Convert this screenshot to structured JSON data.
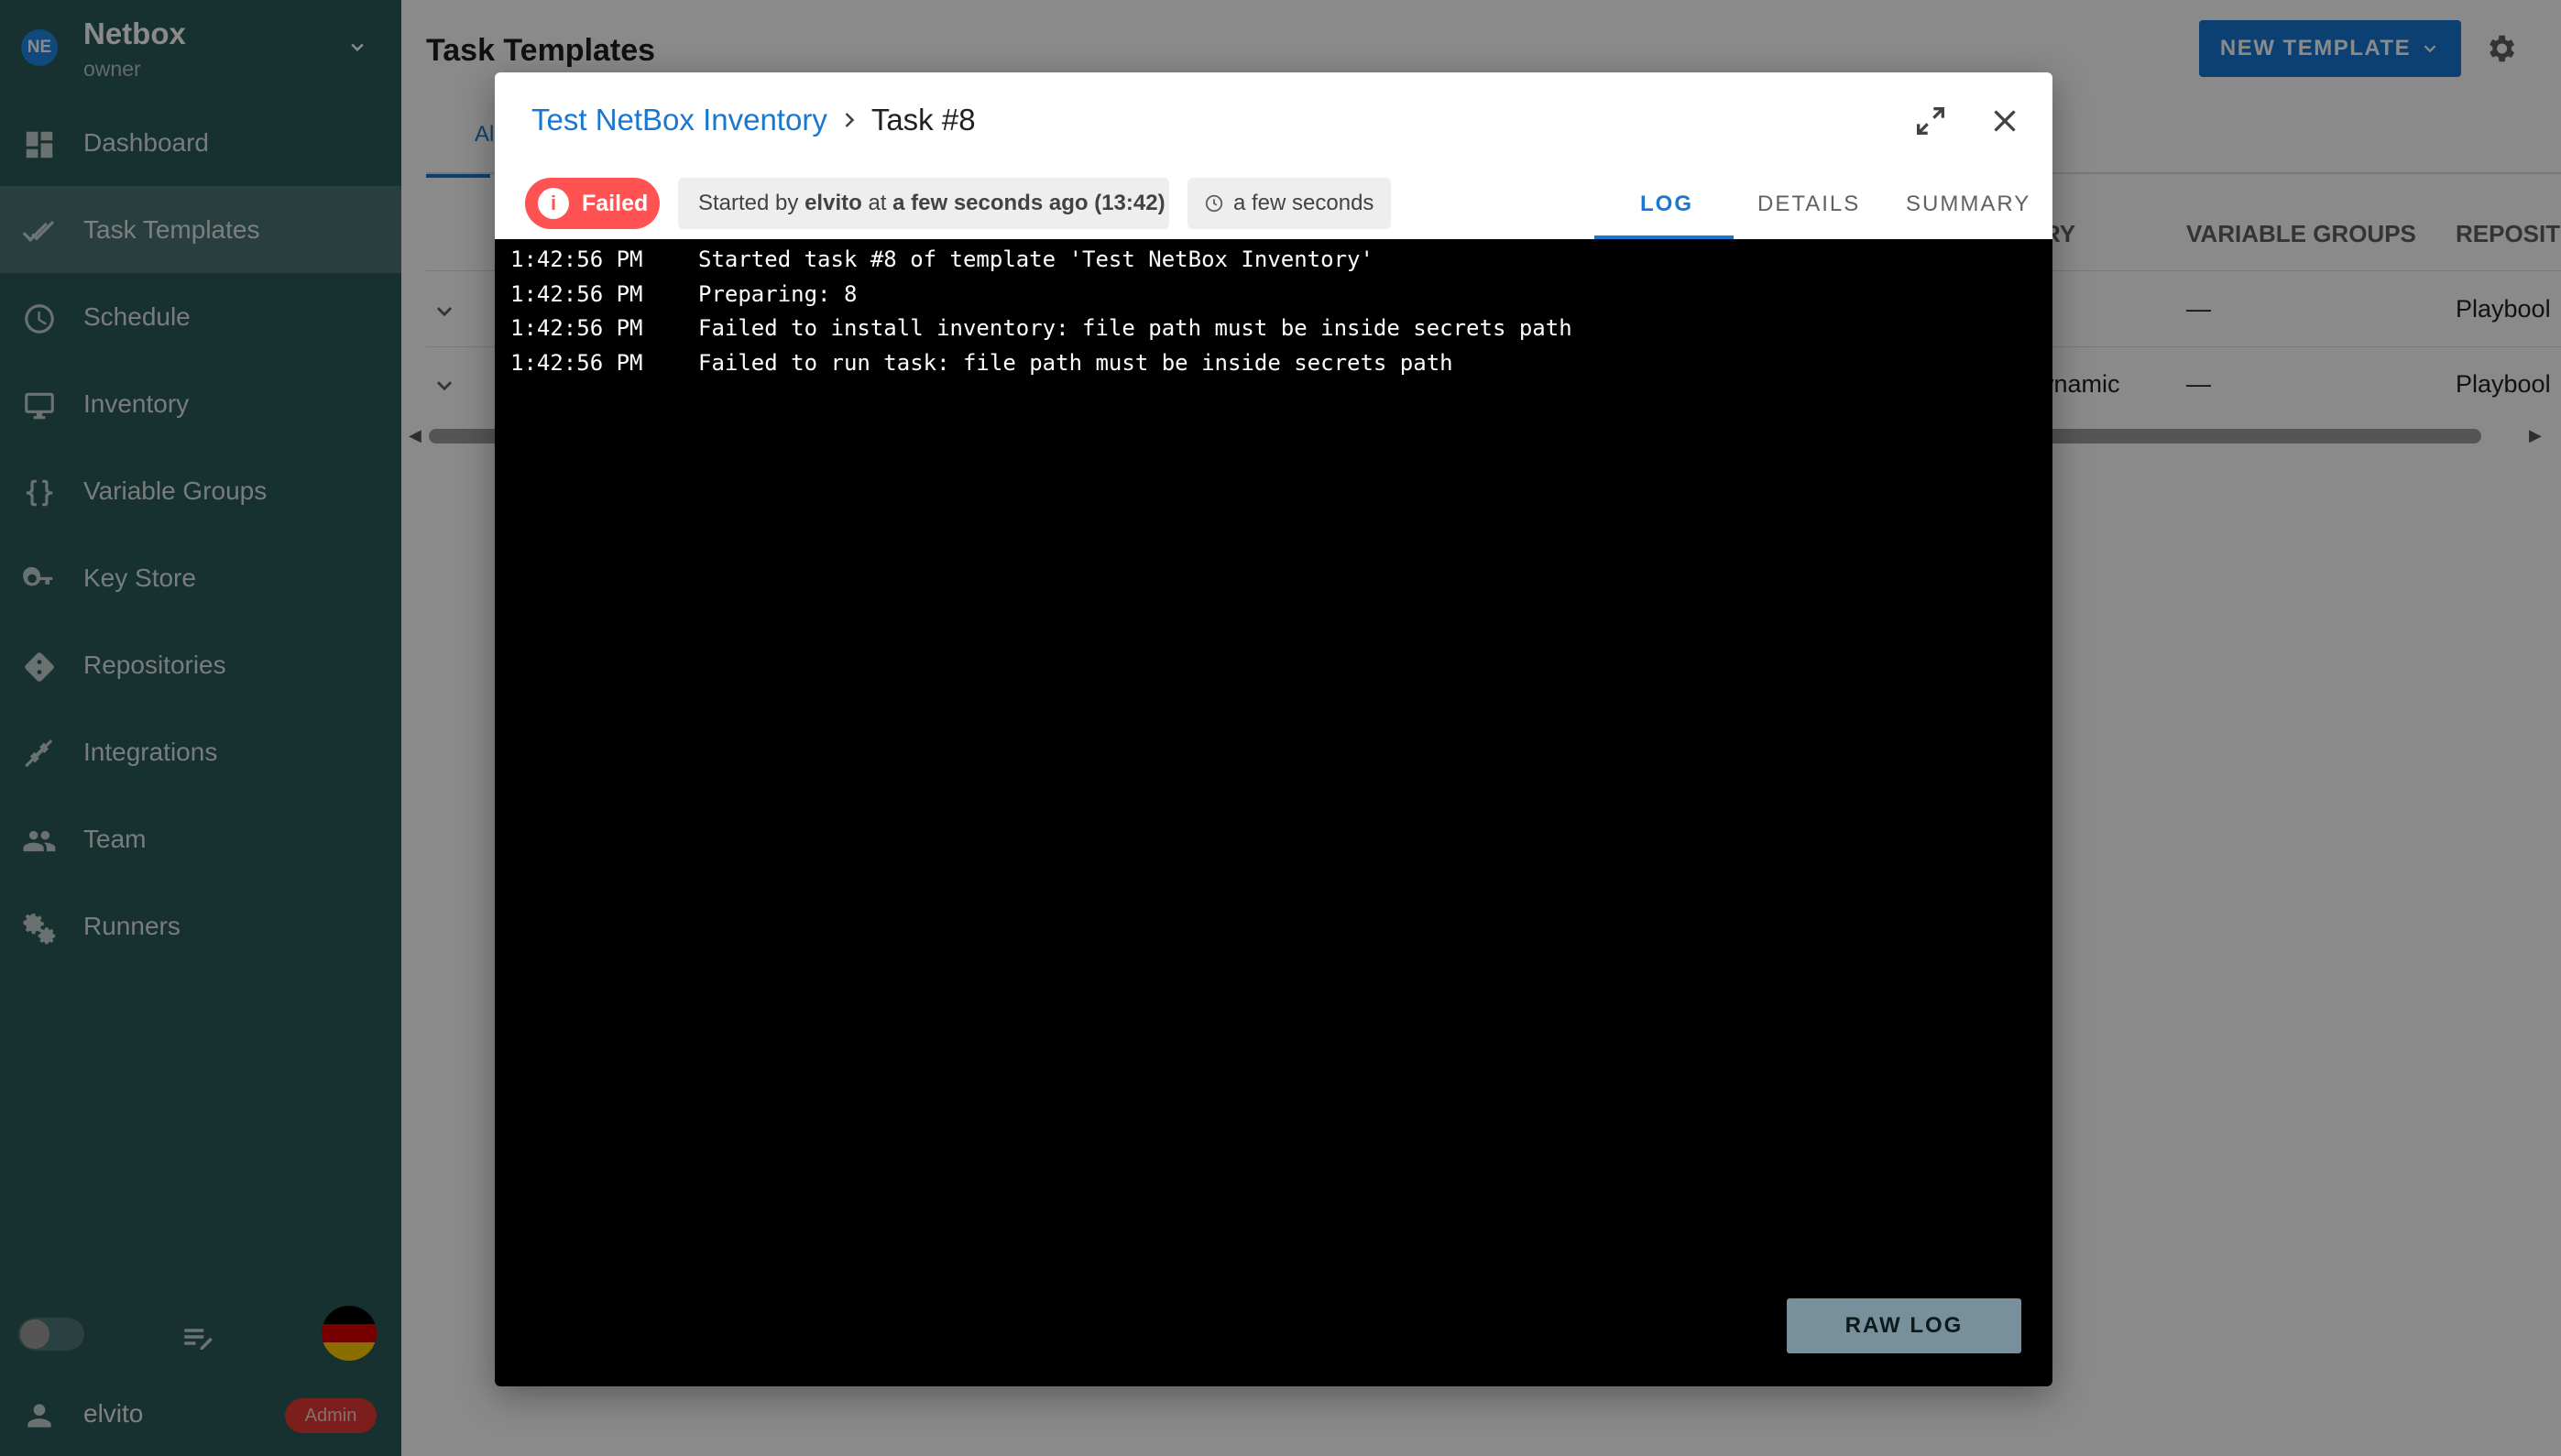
{
  "sidebar": {
    "project": {
      "initials": "NE",
      "name": "Netbox",
      "role": "owner"
    },
    "items": [
      {
        "label": "Dashboard",
        "icon": "dashboard-icon"
      },
      {
        "label": "Task Templates",
        "icon": "checks-icon",
        "active": true
      },
      {
        "label": "Schedule",
        "icon": "clock-icon"
      },
      {
        "label": "Inventory",
        "icon": "monitor-icon"
      },
      {
        "label": "Variable Groups",
        "icon": "braces-icon"
      },
      {
        "label": "Key Store",
        "icon": "key-icon"
      },
      {
        "label": "Repositories",
        "icon": "git-icon"
      },
      {
        "label": "Integrations",
        "icon": "plug-icon"
      },
      {
        "label": "Team",
        "icon": "team-icon"
      },
      {
        "label": "Runners",
        "icon": "cogs-icon"
      }
    ],
    "user": {
      "name": "elvito",
      "badge": "Admin"
    }
  },
  "page": {
    "title": "Task Templates",
    "new_button": "NEW TEMPLATE",
    "tab_partial": "Al",
    "table": {
      "headers": [
        "RY",
        "VARIABLE GROUPS",
        "REPOSIT"
      ],
      "rows": [
        {
          "inventory": "",
          "variable_groups": "—",
          "repository": "Playbool"
        },
        {
          "inventory": "ynamic",
          "variable_groups": "—",
          "repository": "Playbool"
        }
      ]
    }
  },
  "dialog": {
    "template_name": "Test NetBox Inventory",
    "task": "Task #8",
    "status": "Failed",
    "started": {
      "prefix": "Started by",
      "user": "elvito",
      "mid": "at",
      "when": "a few seconds ago (13:42)"
    },
    "duration": "a few seconds",
    "tabs": [
      "LOG",
      "DETAILS",
      "SUMMARY"
    ],
    "log": [
      {
        "time": "1:42:56 PM",
        "text": "Started task #8 of template 'Test NetBox Inventory'"
      },
      {
        "time": "1:42:56 PM",
        "text": "Preparing: 8"
      },
      {
        "time": "1:42:56 PM",
        "text": "Failed to install inventory: file path must be inside secrets path"
      },
      {
        "time": "1:42:56 PM",
        "text": "Failed to run task: file path must be inside secrets path"
      }
    ],
    "raw_log_button": "RAW LOG"
  },
  "colors": {
    "sidebar": "#2b5a5a",
    "primary": "#1976d2",
    "failed": "#ff5252",
    "admin_badge": "#e53935"
  }
}
